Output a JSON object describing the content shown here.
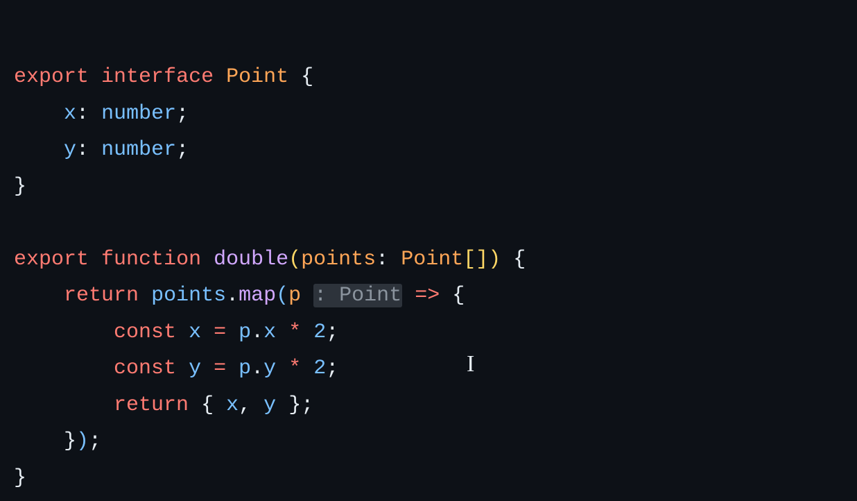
{
  "code": {
    "tokens": {
      "export": "export",
      "interface": "interface",
      "function": "function",
      "return": "return",
      "const": "const",
      "Point": "Point",
      "double": "double",
      "points": "points",
      "map": "map",
      "number": "number",
      "x": "x",
      "y": "y",
      "p": "p",
      "two": "2",
      "lbrace": "{",
      "rbrace": "}",
      "lparen": "(",
      "rparen": ")",
      "lbracket": "[",
      "rbracket": "]",
      "colon": ":",
      "semi": ";",
      "comma": ",",
      "dot": ".",
      "eq": "=",
      "star": "*",
      "arrow": "=>"
    },
    "inlay_hint": ": Point"
  }
}
